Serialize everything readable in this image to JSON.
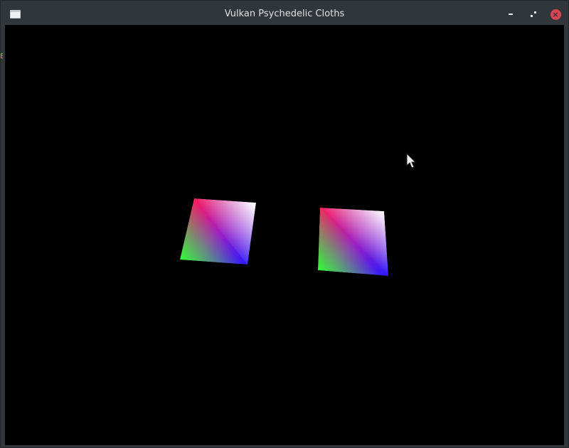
{
  "window": {
    "title": "Vulkan Psychedelic Cloths",
    "controls": {
      "minimize_icon": "minimize-icon",
      "maximize_icon": "maximize-icon",
      "close_icon": "close-icon",
      "close_glyph": "×"
    },
    "close_color": "#da4453",
    "titlebar_color": "#31363b"
  },
  "viewport": {
    "background": "#000000",
    "cloths": [
      {
        "name": "left-cloth"
      },
      {
        "name": "right-cloth"
      }
    ]
  },
  "edge_text": "E"
}
